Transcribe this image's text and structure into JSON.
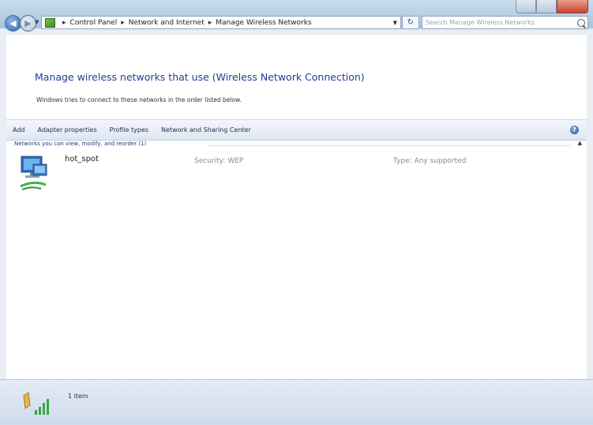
{
  "address": {
    "crumbs": [
      "Control Panel",
      "Network and Internet",
      "Manage Wireless Networks"
    ],
    "search_placeholder": "Search Manage Wireless Networks"
  },
  "header": {
    "title": "Manage wireless networks that use (Wireless Network Connection)",
    "subtitle": "Windows tries to connect to these networks in the order listed below."
  },
  "toolbar": {
    "items": [
      "Add",
      "Adapter properties",
      "Profile types",
      "Network and Sharing Center"
    ]
  },
  "group": {
    "label": "Networks you can view, modify, and reorder (1)"
  },
  "networks": [
    {
      "name": "hot_spot",
      "security": "Security: WEP",
      "type": "Type: Any supported"
    }
  ],
  "status": {
    "count": "1 item"
  }
}
